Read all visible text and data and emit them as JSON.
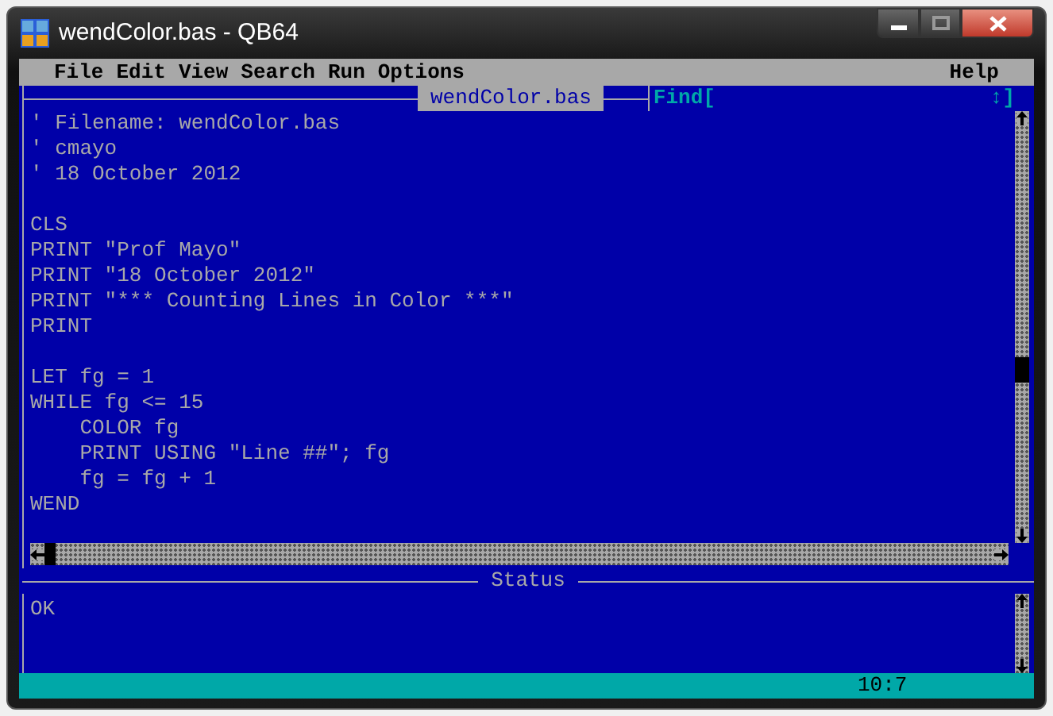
{
  "window": {
    "title": "wendColor.bas - QB64"
  },
  "menu": {
    "left": [
      "File",
      "Edit",
      "View",
      "Search",
      "Run",
      "Options"
    ],
    "right": [
      "Help"
    ]
  },
  "editor": {
    "title": "wendColor.bas",
    "find_label": "Find[",
    "find_end": "↕]",
    "code_blocks": [
      [
        "' Filename: wendColor.bas",
        "' cmayo",
        "' 18 October 2012"
      ],
      [
        "CLS",
        "PRINT \"Prof Mayo\"",
        "PRINT \"18 October 2012\"",
        "PRINT \"*** Counting Lines in Color ***\"",
        "PRINT"
      ],
      [
        "LET fg = 1",
        "WHILE fg <= 15",
        "    COLOR fg",
        "    PRINT USING \"Line ##\"; fg",
        "    fg = fg + 1",
        "WEND"
      ]
    ]
  },
  "status": {
    "title": "Status",
    "message": "OK"
  },
  "status_bar": {
    "position": "10:7"
  }
}
